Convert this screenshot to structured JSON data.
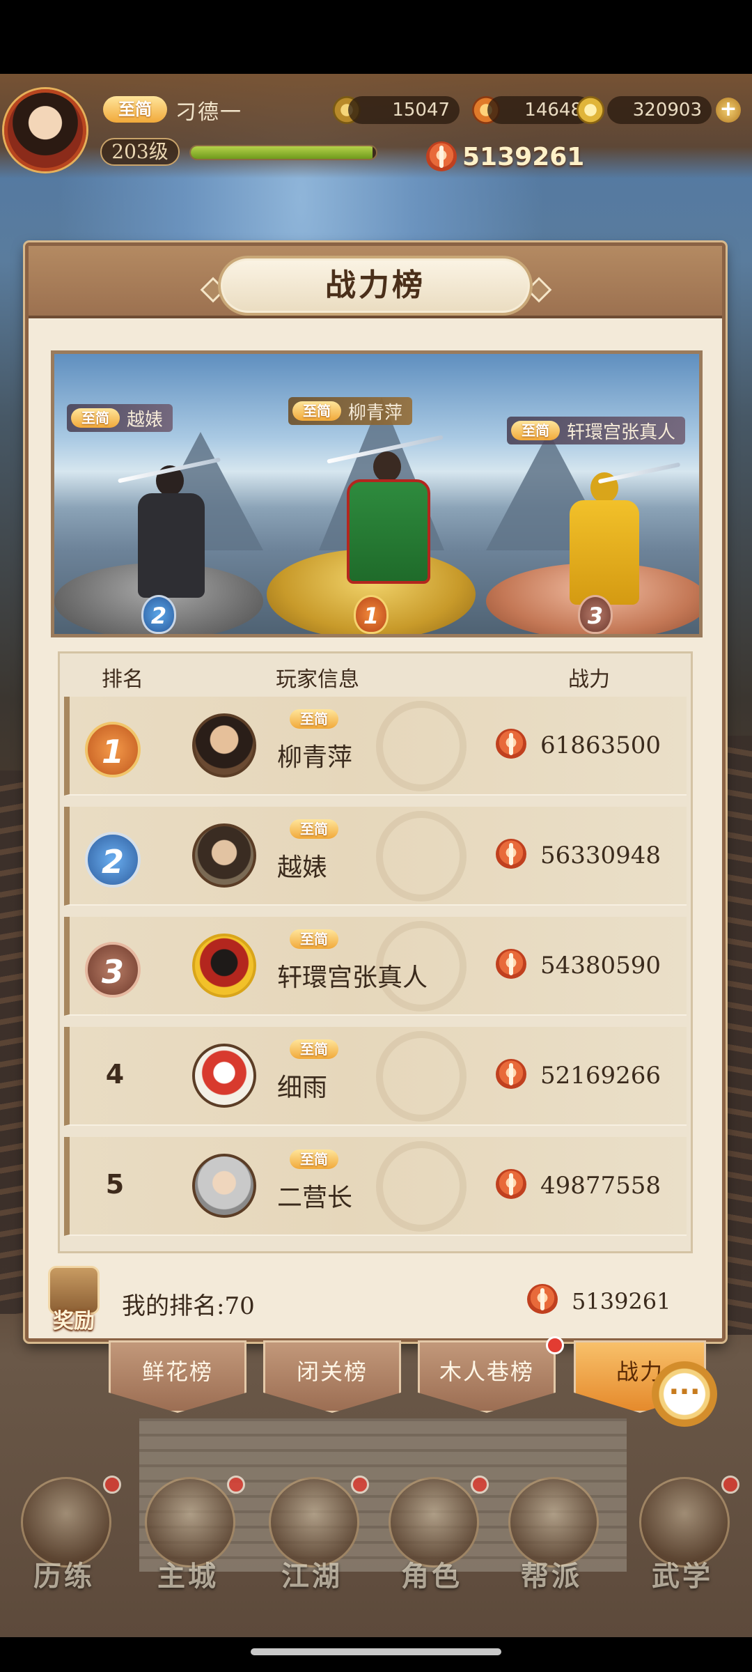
{
  "player": {
    "vip_label": "至简",
    "name": "刁德一",
    "level": "203级",
    "exp_fraction": 0.98,
    "power": "5139261"
  },
  "currencies": [
    {
      "icon": "copper-coin-icon",
      "value": "15047"
    },
    {
      "icon": "flame-token-icon",
      "value": "14648"
    },
    {
      "icon": "gold-ingot-icon",
      "value": "320903"
    }
  ],
  "panel": {
    "title": "战力榜"
  },
  "podium": [
    {
      "rank": "2",
      "vip": "至简",
      "name": "越婊"
    },
    {
      "rank": "1",
      "vip": "至简",
      "name": "柳青萍"
    },
    {
      "rank": "3",
      "vip": "至简",
      "name": "轩環宫张真人"
    }
  ],
  "table": {
    "headers": {
      "rank": "排名",
      "info": "玩家信息",
      "power": "战力"
    },
    "rows": [
      {
        "rank": "1",
        "vip": "至简",
        "name": "柳青萍",
        "power": "61863500"
      },
      {
        "rank": "2",
        "vip": "至简",
        "name": "越婊",
        "power": "56330948"
      },
      {
        "rank": "3",
        "vip": "至简",
        "name": "轩環宫张真人",
        "power": "54380590"
      },
      {
        "rank": "4",
        "vip": "至简",
        "name": "细雨",
        "power": "52169266"
      },
      {
        "rank": "5",
        "vip": "至简",
        "name": "二营长",
        "power": "49877558"
      }
    ]
  },
  "my_rank": {
    "reward_label": "奖励",
    "text": "我的排名:70",
    "power": "5139261"
  },
  "tabs": [
    {
      "label": "鲜花榜",
      "active": false
    },
    {
      "label": "闭关榜",
      "active": false
    },
    {
      "label": "木人巷榜",
      "active": false
    },
    {
      "label": "战力",
      "active": true
    }
  ],
  "nav": [
    {
      "label": "历练"
    },
    {
      "label": "主城"
    },
    {
      "label": "江湖"
    },
    {
      "label": "角色"
    },
    {
      "label": "帮派"
    },
    {
      "label": "武学"
    }
  ],
  "colors": {
    "accent_gold": "#f1a93a",
    "panel_bg": "#f3ead9",
    "panel_border": "#8a6244",
    "alert_red": "#e23c32"
  }
}
